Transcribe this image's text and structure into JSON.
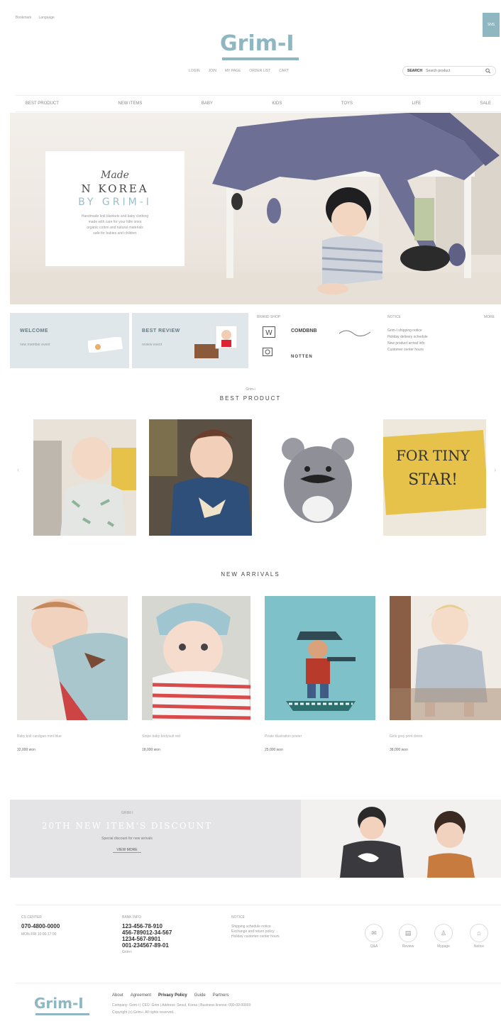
{
  "topbar": {
    "links": [
      "Bookmark",
      "Language"
    ]
  },
  "corner_tag": "SNS",
  "logo": {
    "text": "Grim-I"
  },
  "utility_nav": [
    "LOGIN",
    "JOIN",
    "MY PAGE",
    "ORDER LIST",
    "CART"
  ],
  "search": {
    "label": "SEARCH",
    "placeholder": "Search product"
  },
  "main_nav": [
    "BEST PRODUCT",
    "NEW ITEMS",
    "BABY",
    "KIDS",
    "TOYS",
    "LIFE",
    "SALE"
  ],
  "hero": {
    "line1": "Made",
    "line2": "N KOREA",
    "line3": "BY GRIM-I",
    "desc": [
      "Handmade knit blankets and baby clothing",
      "made with care for your little ones",
      "organic cotton and natural materials",
      "safe for babies and children"
    ]
  },
  "promos": [
    {
      "title": "WELCOME",
      "sub": "new member event"
    },
    {
      "title": "BEST REVIEW",
      "sub": "review event"
    }
  ],
  "brands": {
    "heading": "BRAND SHOP",
    "items": [
      "COMDBNB",
      "NOTTEN"
    ]
  },
  "notice": {
    "heading": "NOTICE",
    "more": "MORE",
    "items": [
      "Grim-I shipping notice",
      "Holiday delivery schedule",
      "New product arrival info",
      "Customer center hours"
    ]
  },
  "best_product": {
    "pretitle": "Grim-i",
    "title": "BEST PRODUCT"
  },
  "new_arrivals": {
    "title": "NEW ARRIVALS"
  },
  "new_products": [
    {
      "name": "Baby knit cardigan mint blue",
      "price": "32,000 won"
    },
    {
      "name": "Stripe baby bodysuit red",
      "price": "18,000 won"
    },
    {
      "name": "Pirate illustration poster",
      "price": "25,000 won"
    },
    {
      "name": "Girls grey print dress",
      "price": "38,000 won"
    }
  ],
  "banner": {
    "small": "GRIM-I",
    "title": "20TH NEW ITEM'S DISCOUNT",
    "sub": "Special discount for new arrivals",
    "button": "VIEW MORE"
  },
  "footer": {
    "cs": {
      "label": "CS CENTER",
      "phone": "070-4800-0000",
      "hours": "MON-FRI 10:00-17:00"
    },
    "bank": {
      "label": "BANK INFO",
      "accounts": [
        "123-456-78-910",
        "456-789012-34-567",
        "1234-567-8901",
        "001-234567-89-01"
      ],
      "holder": "Grim-i"
    },
    "notice": {
      "label": "NOTICE",
      "lines": [
        "Shipping schedule notice",
        "Exchange and return policy",
        "Holiday customer center hours"
      ]
    },
    "icons": [
      {
        "icon": "mail-icon",
        "label": "Q&A"
      },
      {
        "icon": "bag-icon",
        "label": "Review"
      },
      {
        "icon": "user-icon",
        "label": "Mypage"
      },
      {
        "icon": "home-icon",
        "label": "Notice"
      }
    ]
  },
  "bottom": {
    "logo": "Grim-I",
    "links": [
      "About",
      "Agreement",
      "Privacy Policy",
      "Guide",
      "Partners"
    ],
    "info": "Company: Grim-i | CEO: Grim | Address: Seoul, Korea | Business license: 000-00-00000",
    "copyright": "Copyright (c) Grim-i. All rights reserved."
  }
}
